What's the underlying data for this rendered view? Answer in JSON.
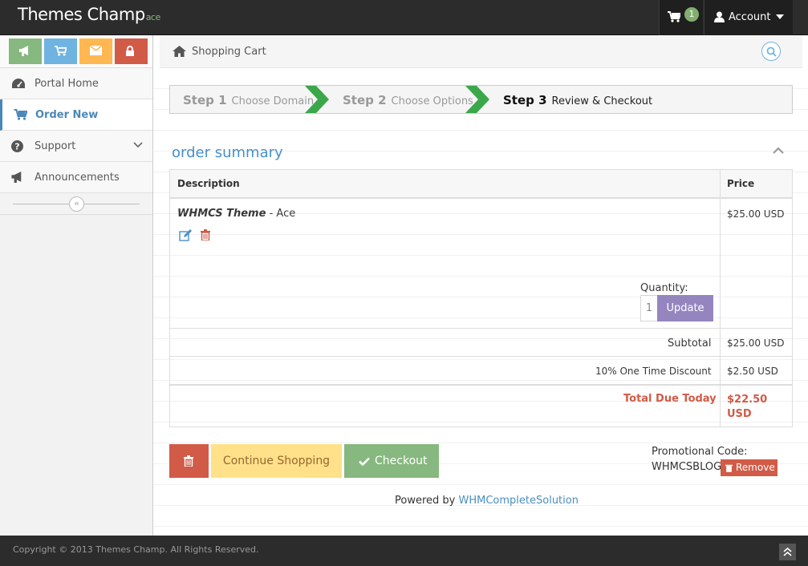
{
  "header": {
    "brand": "Themes Champ",
    "brand_sub": "ace",
    "cart_count": "1",
    "account_label": "Account"
  },
  "sidebar": {
    "shortcuts": [
      {
        "icon": "bullhorn-icon",
        "color": "#87b87f"
      },
      {
        "icon": "cart-icon",
        "color": "#6fb3e0"
      },
      {
        "icon": "envelope-icon",
        "color": "#ffb752"
      },
      {
        "icon": "lock-icon",
        "color": "#d15b47"
      }
    ],
    "items": [
      {
        "label": "Portal Home",
        "icon": "dashboard-icon"
      },
      {
        "label": "Order New",
        "icon": "cart-icon",
        "active": true
      },
      {
        "label": "Support",
        "icon": "question-circle-icon"
      },
      {
        "label": "Announcements",
        "icon": "bullhorn-icon"
      }
    ]
  },
  "breadcrumb": {
    "label": "Shopping Cart"
  },
  "wizard": {
    "steps": [
      {
        "num": "Step 1",
        "name": "Choose Domain"
      },
      {
        "num": "Step 2",
        "name": "Choose Options"
      },
      {
        "num": "Step 3",
        "name": "Review & Checkout"
      }
    ]
  },
  "summary": {
    "title": "order summary",
    "col_description": "Description",
    "col_price": "Price",
    "item": {
      "product": "WHMCS Theme",
      "name": "Ace",
      "price": "$25.00 USD"
    },
    "quantity_label": "Quantity:",
    "quantity_value": "1",
    "update_label": "Update",
    "subtotal_label": "Subtotal",
    "subtotal_value": "$25.00 USD",
    "discount_label": "10% One Time Discount",
    "discount_value": "$2.50 USD",
    "total_label": "Total Due Today",
    "total_amount": "$22.50",
    "total_currency": "USD"
  },
  "actions": {
    "continue_label": "Continue Shopping",
    "checkout_label": "Checkout"
  },
  "promo": {
    "label": "Promotional Code:",
    "code": "WHMCSBLOG",
    "remove_label": "Remove"
  },
  "powered": {
    "prefix": "Powered by",
    "link": "WHMCompleteSolution"
  },
  "footer": {
    "copyright": "Copyright © 2013 Themes Champ. All Rights Reserved."
  },
  "colors": {
    "accent_blue": "#478fca",
    "success_green": "#87b87f",
    "danger_red": "#d15b47",
    "warning_yellow": "#fee188",
    "purple": "#9585bf",
    "step_arrow": "#3aa84a"
  }
}
